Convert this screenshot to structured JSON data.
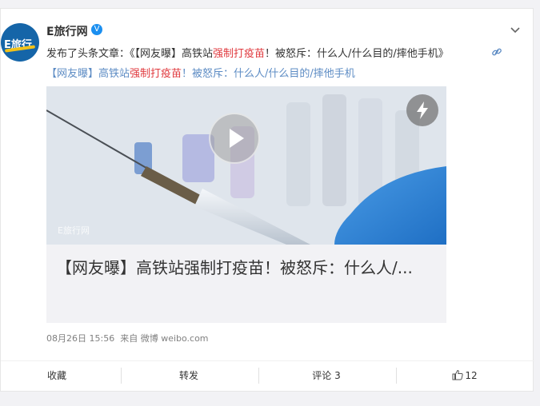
{
  "author": {
    "name": "E旅行网",
    "avatar_text": "E旅行"
  },
  "post": {
    "prefix": "发布了头条文章：《【网友曝】高铁站",
    "highlight": "强制打疫苗",
    "suffix": "！被怒斥：什么人/什么目的/摔他手机》",
    "link_prefix": "【网友曝】高铁站",
    "link_highlight": "强制打疫苗",
    "link_suffix": "！被怒斥：什么人/什么目的/摔他手机"
  },
  "card": {
    "title": "【网友曝】高铁站强制打疫苗！被怒斥：什么人/...",
    "watermark": "E旅行网"
  },
  "meta": {
    "time": "08月26日 15:56",
    "source": "来自 微博 weibo.com"
  },
  "actions": {
    "favorite": "收藏",
    "repost": "转发",
    "comment": "评论 3",
    "like": "12"
  },
  "colors": {
    "accent_blue": "#5d8cc4",
    "highlight_red": "#e0393e",
    "verify_blue": "#1b8ff0"
  }
}
